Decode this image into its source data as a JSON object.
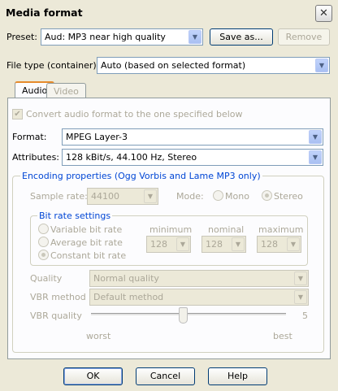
{
  "window": {
    "title": "Media format",
    "close_glyph": "✕"
  },
  "preset": {
    "label": "Preset:",
    "value": "Aud: MP3 near high quality",
    "save_as_label": "Save as...",
    "remove_label": "Remove"
  },
  "file_type": {
    "label": "File type (container):",
    "value": "Auto (based on selected format)"
  },
  "tabs": [
    {
      "label": "Audio",
      "active": true
    },
    {
      "label": "Video",
      "active": false
    }
  ],
  "audio": {
    "convert_label": "Convert audio format to the one specified below",
    "convert_checked": true,
    "format_label": "Format:",
    "format_value": "MPEG Layer-3",
    "attributes_label": "Attributes:",
    "attributes_value": "128 kBit/s, 44.100 Hz, Stereo"
  },
  "encoding": {
    "title": "Encoding properties (Ogg Vorbis and Lame MP3 only)",
    "sample_rate_label": "Sample rate:",
    "sample_rate_value": "44100",
    "mode_label": "Mode:",
    "mode_options": [
      "Mono",
      "Stereo"
    ],
    "mode_selected": "Stereo",
    "bitrate": {
      "title": "Bit rate settings",
      "options": [
        "Variable bit rate",
        "Average bit rate",
        "Constant bit rate"
      ],
      "selected": "Constant bit rate",
      "minimum_label": "minimum",
      "nominal_label": "nominal",
      "maximum_label": "maximum",
      "minimum_value": "128",
      "nominal_value": "128",
      "maximum_value": "128"
    },
    "quality_label": "Quality",
    "quality_value": "Normal quality",
    "vbr_method_label": "VBR method",
    "vbr_method_value": "Default method",
    "vbr_quality_label": "VBR quality",
    "vbr_quality_value": "5",
    "vbr_quality_level": 0.5,
    "worst_label": "worst",
    "best_label": "best"
  },
  "footer": {
    "ok_label": "OK",
    "cancel_label": "Cancel",
    "help_label": "Help"
  },
  "colors": {
    "accent_blue": "#0046d5",
    "tab_highlight": "#e68b2c",
    "disabled_text": "#aca899"
  }
}
